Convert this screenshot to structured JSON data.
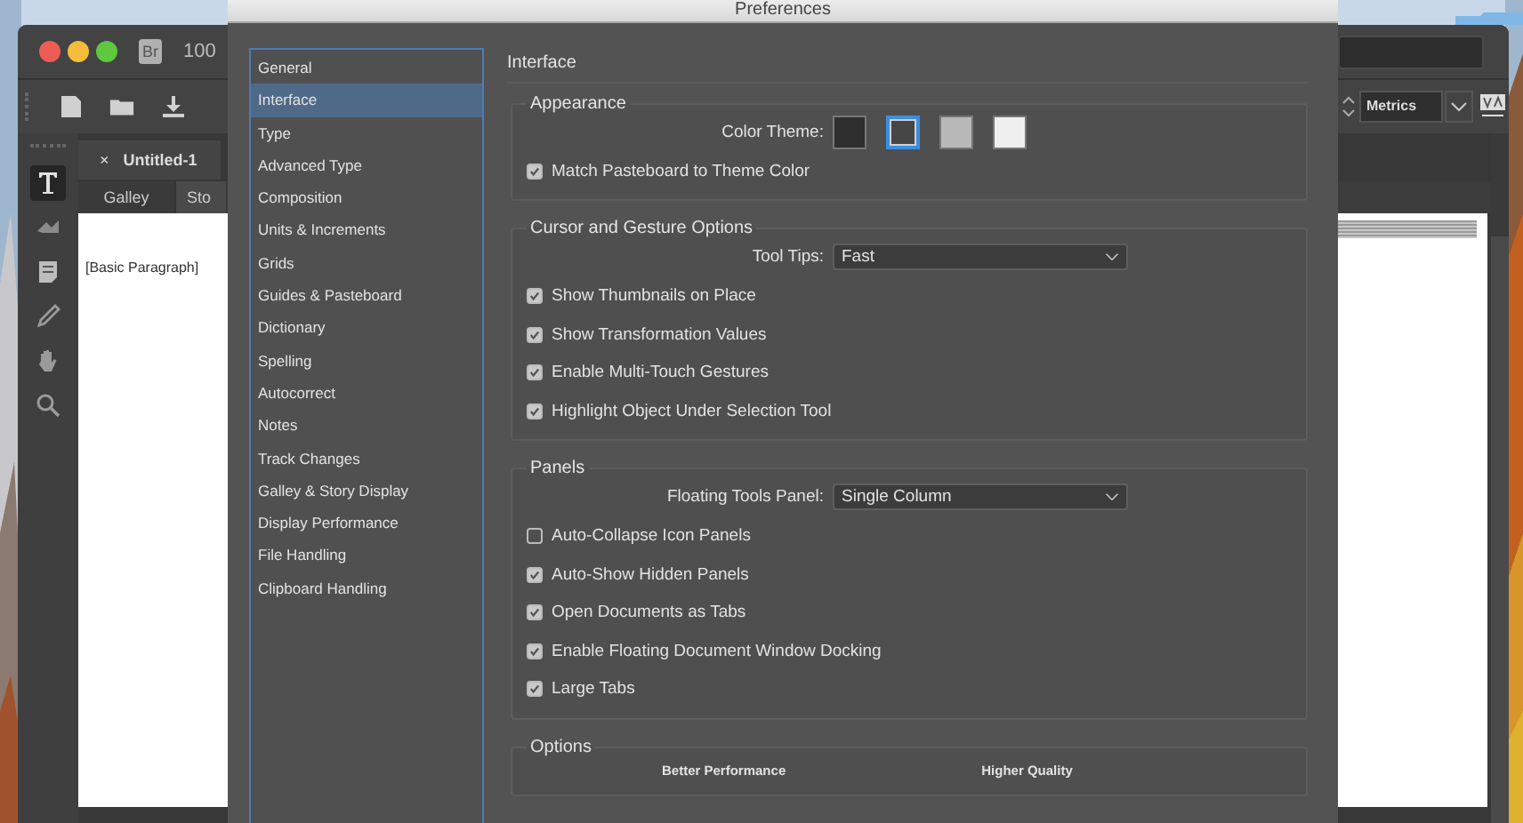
{
  "app": {
    "badge": "Br",
    "zoom": "100",
    "kerning": "Metrics",
    "document_tab": {
      "close": "×",
      "title": "Untitled-1"
    },
    "view_tabs": [
      {
        "label": "Galley",
        "selected": true
      },
      {
        "label": "Sto",
        "selected": false
      }
    ],
    "paragraph_style": "[Basic Paragraph]"
  },
  "dialog": {
    "title": "Preferences",
    "categories": [
      {
        "label": "General",
        "selected": false
      },
      {
        "label": "Interface",
        "selected": true
      },
      {
        "label": "Type",
        "selected": false
      },
      {
        "label": "Advanced Type",
        "selected": false
      },
      {
        "label": "Composition",
        "selected": false
      },
      {
        "label": "Units & Increments",
        "selected": false
      },
      {
        "label": "Grids",
        "selected": false
      },
      {
        "label": "Guides & Pasteboard",
        "selected": false
      },
      {
        "label": "Dictionary",
        "selected": false
      },
      {
        "label": "Spelling",
        "selected": false
      },
      {
        "label": "Autocorrect",
        "selected": false
      },
      {
        "label": "Notes",
        "selected": false
      },
      {
        "label": "Track Changes",
        "selected": false
      },
      {
        "label": "Galley & Story Display",
        "selected": false
      },
      {
        "label": "Display Performance",
        "selected": false
      },
      {
        "label": "File Handling",
        "selected": false
      },
      {
        "label": "Clipboard Handling",
        "selected": false
      }
    ],
    "heading": "Interface",
    "sections": [
      {
        "title": "Appearance",
        "rows": [
          {
            "kind": "swatches",
            "label": "Color Theme:",
            "swatches": [
              {
                "color": "#2f2f2f",
                "selected": false
              },
              {
                "color": "#464646",
                "selected": true
              },
              {
                "color": "#b8b8b8",
                "selected": false
              },
              {
                "color": "#efefef",
                "selected": false
              }
            ]
          },
          {
            "kind": "checkbox",
            "label": "Match Pasteboard to Theme Color",
            "checked": true
          }
        ]
      },
      {
        "title": "Cursor and Gesture Options",
        "rows": [
          {
            "kind": "select",
            "label": "Tool Tips:",
            "value": "Fast"
          },
          {
            "kind": "checkbox",
            "label": "Show Thumbnails on Place",
            "checked": true
          },
          {
            "kind": "checkbox",
            "label": "Show Transformation Values",
            "checked": true
          },
          {
            "kind": "checkbox",
            "label": "Enable Multi-Touch Gestures",
            "checked": true
          },
          {
            "kind": "checkbox",
            "label": "Highlight Object Under Selection Tool",
            "checked": true
          }
        ]
      },
      {
        "title": "Panels",
        "rows": [
          {
            "kind": "select",
            "label": "Floating Tools Panel:",
            "value": "Single Column"
          },
          {
            "kind": "checkbox",
            "label": "Auto-Collapse Icon Panels",
            "checked": false
          },
          {
            "kind": "checkbox",
            "label": "Auto-Show Hidden Panels",
            "checked": true
          },
          {
            "kind": "checkbox",
            "label": "Open Documents as Tabs",
            "checked": true
          },
          {
            "kind": "checkbox",
            "label": "Enable Floating Document Window Docking",
            "checked": true
          },
          {
            "kind": "checkbox",
            "label": "Large Tabs",
            "checked": true
          }
        ]
      },
      {
        "title": "Options",
        "rows": [
          {
            "kind": "scale",
            "labels": [
              "Better Performance",
              "Higher Quality"
            ]
          }
        ]
      }
    ]
  }
}
